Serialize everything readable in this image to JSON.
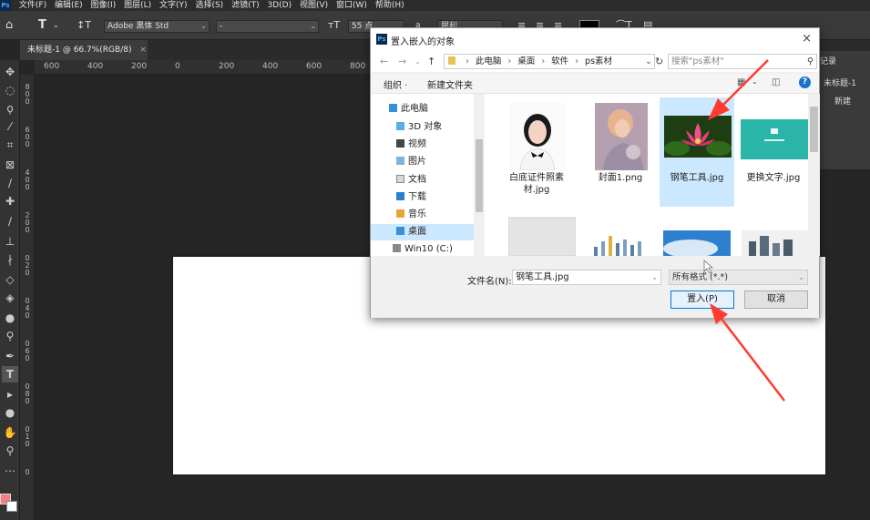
{
  "menubar": {
    "items": [
      "文件(F)",
      "编辑(E)",
      "图像(I)",
      "图层(L)",
      "文字(Y)",
      "选择(S)",
      "滤镜(T)",
      "3D(D)",
      "视图(V)",
      "窗口(W)",
      "帮助(H)"
    ]
  },
  "optionsbar": {
    "font_family": "Adobe 黑体 Std",
    "font_style": "-",
    "font_size": "55 点",
    "aa_label": "a",
    "aa_mode": "犀利"
  },
  "document_tab": {
    "title": "未标题-1 @ 66.7%(RGB/8)",
    "close": "×"
  },
  "ruler_h": [
    "600",
    "400",
    "200",
    "0",
    "200",
    "400",
    "600",
    "800"
  ],
  "ruler_v": [
    "8",
    "0",
    "0",
    "6",
    "0",
    "0",
    "4",
    "0",
    "0",
    "2",
    "0",
    "0",
    "0",
    "2",
    "0",
    "0",
    "4",
    "0",
    "0",
    "6",
    "0",
    "0",
    "8",
    "0",
    "0",
    "1",
    "0",
    "0"
  ],
  "right_panel": {
    "title": "记录",
    "doc_name": "未标题-1",
    "new_label": "新建"
  },
  "colors": {
    "foreground": "#f08080",
    "background": "#ffffff",
    "accent_arrow": "#ff3b30"
  },
  "dialog": {
    "title": "置入嵌入的对象",
    "close_symbol": "×",
    "breadcrumb": [
      "此电脑",
      "桌面",
      "软件",
      "ps素材"
    ],
    "search_placeholder": "搜索\"ps素材\"",
    "organize_label": "组织 ·",
    "new_folder_label": "新建文件夹",
    "help_symbol": "?",
    "nav_items": [
      {
        "label": "此电脑",
        "icon": "computer-icon"
      },
      {
        "label": "3D 对象",
        "icon": "3d-objects-icon"
      },
      {
        "label": "视频",
        "icon": "video-icon"
      },
      {
        "label": "图片",
        "icon": "pictures-icon"
      },
      {
        "label": "文档",
        "icon": "documents-icon"
      },
      {
        "label": "下载",
        "icon": "download-icon"
      },
      {
        "label": "音乐",
        "icon": "music-icon"
      },
      {
        "label": "桌面",
        "icon": "desktop-icon",
        "selected": true
      },
      {
        "label": "Win10 (C:)",
        "icon": "drive-icon"
      }
    ],
    "files": [
      {
        "name": "白底证件照素材.jpg",
        "kind": "portrait-photo"
      },
      {
        "name": "封面1.png",
        "kind": "painting-photo"
      },
      {
        "name": "钢笔工具.jpg",
        "kind": "lotus-photo",
        "selected": true
      },
      {
        "name": "更换文字.jpg",
        "kind": "teal-banner"
      }
    ],
    "filename_label": "文件名(N):",
    "filename_value": "钢笔工具.jpg",
    "format_value": "所有格式 (*.*)",
    "place_button": "置入(P)",
    "cancel_button": "取消"
  }
}
